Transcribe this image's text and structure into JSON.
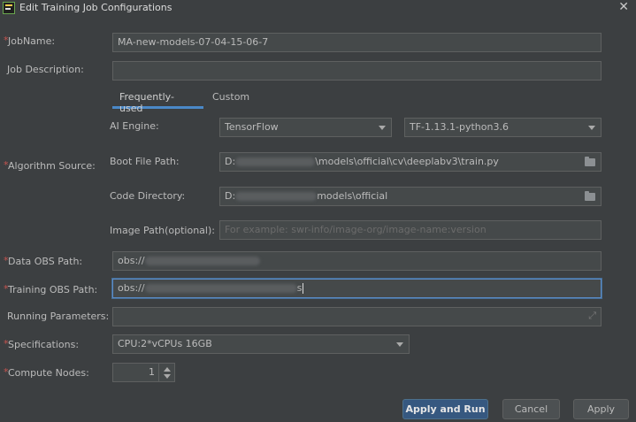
{
  "window": {
    "title": "Edit Training Job Configurations",
    "close_glyph": "✕"
  },
  "labels": {
    "job_name": "JobName:",
    "job_description": "Job Description:",
    "algorithm_source": "Algorithm Source:",
    "ai_engine": "AI Engine:",
    "boot_file_path": "Boot File Path:",
    "code_directory": "Code Directory:",
    "image_path": "Image Path(optional):",
    "data_obs_path": "Data OBS Path:",
    "training_obs_path": "Training OBS Path:",
    "running_parameters": "Running Parameters:",
    "specifications": "Specifications:",
    "compute_nodes": "Compute Nodes:"
  },
  "fields": {
    "job_name": "MA-new-models-07-04-15-06-7",
    "job_description": "",
    "boot_file_prefix": "D:",
    "boot_file_suffix": "\\models\\official\\cv\\deeplabv3\\train.py",
    "code_dir_prefix": "D:",
    "code_dir_suffix": "models\\official",
    "image_path_placeholder": "For example: swr-info/image-org/image-name:version",
    "data_obs_prefix": "obs://",
    "training_obs_prefix": "obs://",
    "training_obs_suffix": "s",
    "running_parameters": ""
  },
  "tabs": [
    {
      "label": "Frequently-used",
      "active": true
    },
    {
      "label": "Custom",
      "active": false
    }
  ],
  "selects": {
    "ai_engine": "TensorFlow",
    "engine_version": "TF-1.13.1-python3.6",
    "specifications": "CPU:2*vCPUs 16GB"
  },
  "compute_nodes": "1",
  "buttons": {
    "apply_and_run": "Apply and Run",
    "cancel": "Cancel",
    "apply": "Apply"
  },
  "icons": [
    "app-icon",
    "close-icon",
    "folder-icon",
    "chevron-down-icon",
    "expand-icon",
    "stepper-icon"
  ],
  "colors": {
    "background": "#3c3f41",
    "field": "#45494a",
    "accent": "#4a88c7",
    "required": "#c75450",
    "primary_button": "#365880"
  }
}
